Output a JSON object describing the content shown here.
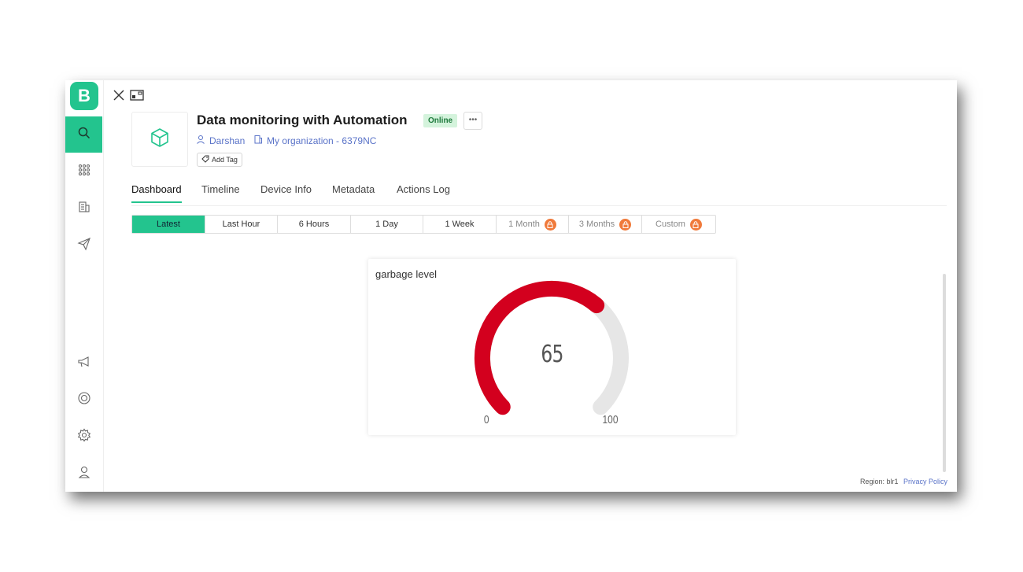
{
  "app": {
    "logo_letter": "B"
  },
  "sidebar": {
    "items": [
      {
        "name": "search",
        "icon": "search-icon"
      },
      {
        "name": "devices",
        "icon": "grid-icon"
      },
      {
        "name": "organizations",
        "icon": "building-icon"
      },
      {
        "name": "messages",
        "icon": "send-icon"
      },
      {
        "name": "announcements",
        "icon": "megaphone-icon"
      },
      {
        "name": "help",
        "icon": "lifebuoy-icon"
      },
      {
        "name": "settings",
        "icon": "gear-icon"
      },
      {
        "name": "profile",
        "icon": "user-icon"
      }
    ]
  },
  "device": {
    "title": "Data monitoring with Automation",
    "status": "Online",
    "owner": "Darshan",
    "organization": "My organization - 6379NC",
    "add_tag_label": "Add Tag",
    "more_label": "•••"
  },
  "tabs": [
    "Dashboard",
    "Timeline",
    "Device Info",
    "Metadata",
    "Actions Log"
  ],
  "active_tab": "Dashboard",
  "time_ranges": [
    {
      "label": "Latest",
      "active": true,
      "locked": false
    },
    {
      "label": "Last Hour",
      "active": false,
      "locked": false
    },
    {
      "label": "6 Hours",
      "active": false,
      "locked": false
    },
    {
      "label": "1 Day",
      "active": false,
      "locked": false
    },
    {
      "label": "1 Week",
      "active": false,
      "locked": false
    },
    {
      "label": "1 Month",
      "active": false,
      "locked": true
    },
    {
      "label": "3 Months",
      "active": false,
      "locked": true
    },
    {
      "label": "Custom",
      "active": false,
      "locked": true
    }
  ],
  "widget": {
    "title": "garbage level",
    "value": 65,
    "value_label": "65",
    "min": 0,
    "max": 100,
    "min_label": "0",
    "max_label": "100",
    "color": "#d3001e"
  },
  "footer": {
    "region": "Region: blr1",
    "privacy": "Privacy Policy"
  },
  "colors": {
    "accent": "#23c48e",
    "link": "#5a73c8",
    "lock": "#f07a3b"
  }
}
